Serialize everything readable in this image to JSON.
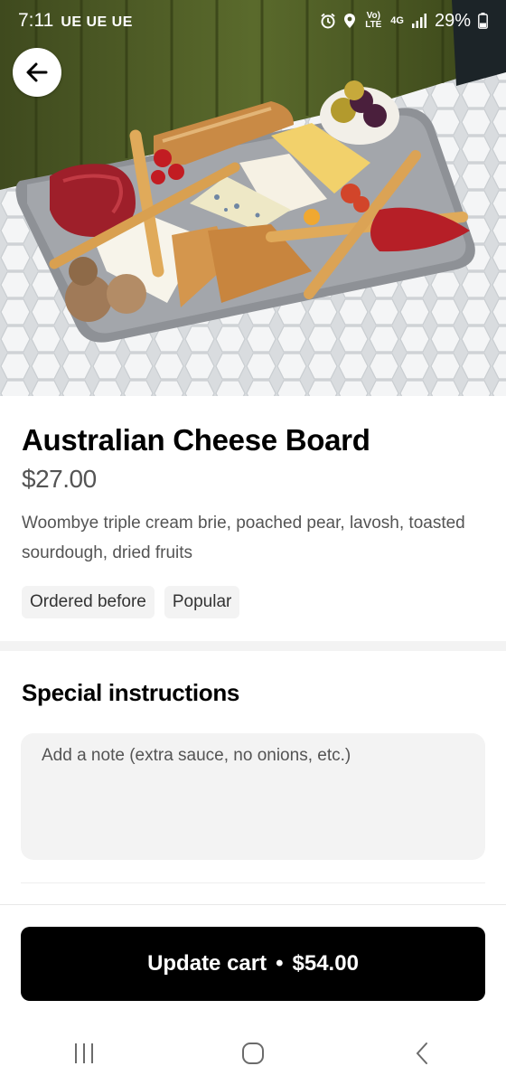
{
  "status_bar": {
    "time": "7:11",
    "carriers": "UE UE UE",
    "battery": "29%",
    "volte_label": "Vo) LTE",
    "network": "4G",
    "icons": [
      "alarm-icon",
      "location-icon",
      "volte-icon",
      "signal-icon",
      "battery-icon"
    ]
  },
  "hero": {
    "image": "cheese-board-photo"
  },
  "item": {
    "title": "Australian Cheese Board",
    "price": "$27.00",
    "description": "Woombye triple cream brie, poached pear, lavosh, toasted sourdough, dried fruits",
    "tags": [
      "Ordered before",
      "Popular"
    ]
  },
  "instructions": {
    "title": "Special instructions",
    "placeholder": "Add a note (extra sauce, no onions, etc.)"
  },
  "cta": {
    "label": "Update cart",
    "separator": "•",
    "total": "$54.00"
  },
  "colors": {
    "cta_bg": "#000000",
    "tag_bg": "#f3f3f3",
    "secondary_text": "#545454"
  }
}
